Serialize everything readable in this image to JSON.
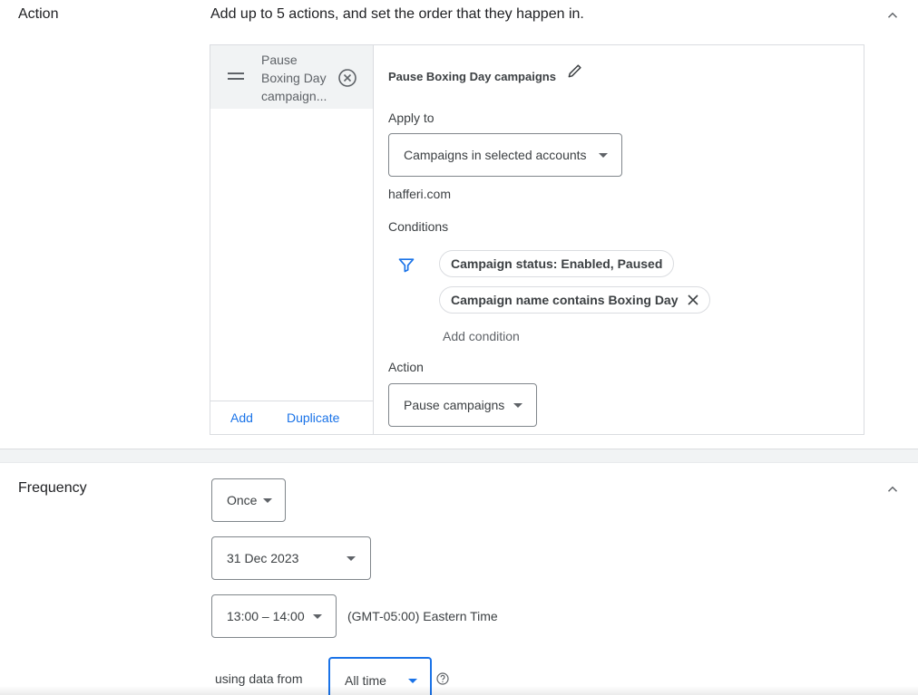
{
  "action_section": {
    "title": "Action",
    "subtitle": "Add up to 5 actions, and set the order that they happen in.",
    "list": {
      "items": [
        {
          "label": "Pause Boxing Day campaign..."
        }
      ],
      "add_label": "Add",
      "duplicate_label": "Duplicate"
    },
    "detail": {
      "name": "Pause Boxing Day campaigns",
      "apply_to_label": "Apply to",
      "apply_to_value": "Campaigns in selected accounts",
      "account": "hafferi.com",
      "conditions_label": "Conditions",
      "conditions": [
        {
          "text": "Campaign status: Enabled, Paused",
          "removable": false
        },
        {
          "text": "Campaign name contains Boxing Day",
          "removable": true
        }
      ],
      "add_condition_label": "Add condition",
      "action_label": "Action",
      "action_value": "Pause campaigns"
    }
  },
  "frequency_section": {
    "title": "Frequency",
    "frequency_value": "Once",
    "date_value": "31 Dec 2023",
    "time_value": "13:00 – 14:00",
    "timezone": "(GMT-05:00) Eastern Time",
    "using_data_label": "using data from",
    "data_range_value": "All time"
  },
  "colors": {
    "accent": "#1a73e8",
    "chip_border": "#dadce0",
    "selected_item_bg": "#f1f3f4"
  },
  "icons": [
    "chevron-up-icon",
    "drag-handle-icon",
    "remove-circle-icon",
    "pencil-icon",
    "filter-icon",
    "close-icon",
    "dropdown-caret-icon",
    "help-icon"
  ]
}
